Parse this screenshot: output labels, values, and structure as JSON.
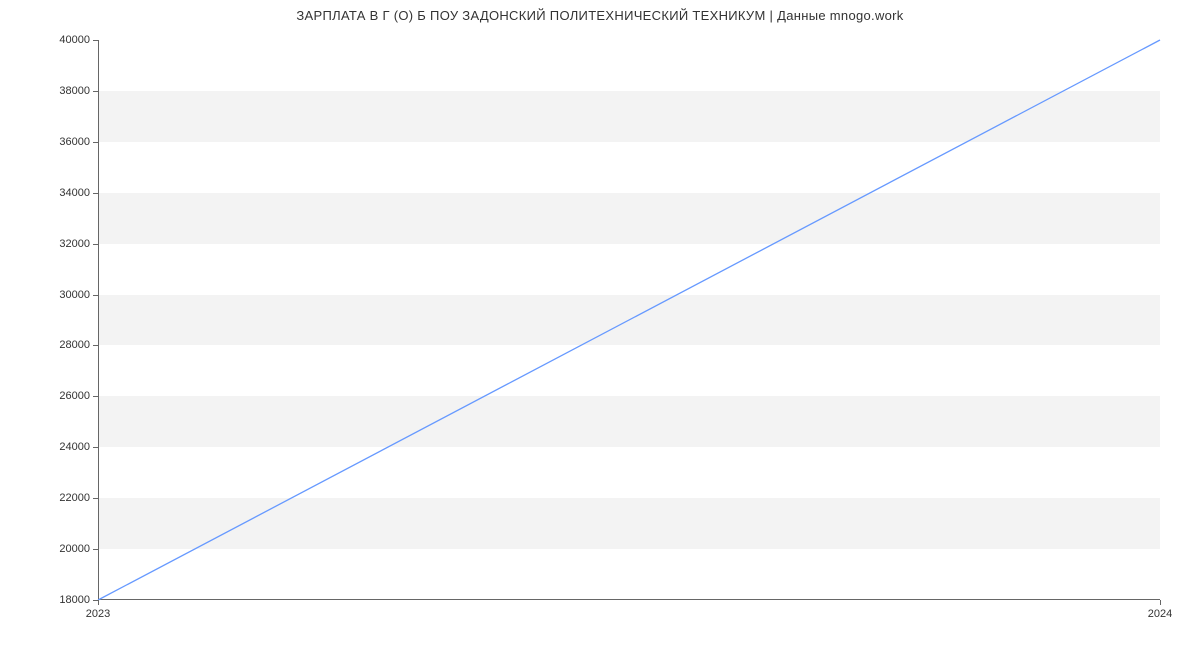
{
  "chart_data": {
    "type": "line",
    "title": "ЗАРПЛАТА В Г (О) Б ПОУ ЗАДОНСКИЙ ПОЛИТЕХНИЧЕСКИЙ ТЕХНИКУМ | Данные mnogo.work",
    "x": [
      2023,
      2024
    ],
    "values": [
      18000,
      40000
    ],
    "xlabel": "",
    "ylabel": "",
    "xlim": [
      2023,
      2024
    ],
    "ylim": [
      18000,
      40000
    ],
    "y_ticks": [
      18000,
      20000,
      22000,
      24000,
      26000,
      28000,
      30000,
      32000,
      34000,
      36000,
      38000,
      40000
    ],
    "x_ticks": [
      2023,
      2024
    ],
    "line_color": "#6699ff"
  }
}
